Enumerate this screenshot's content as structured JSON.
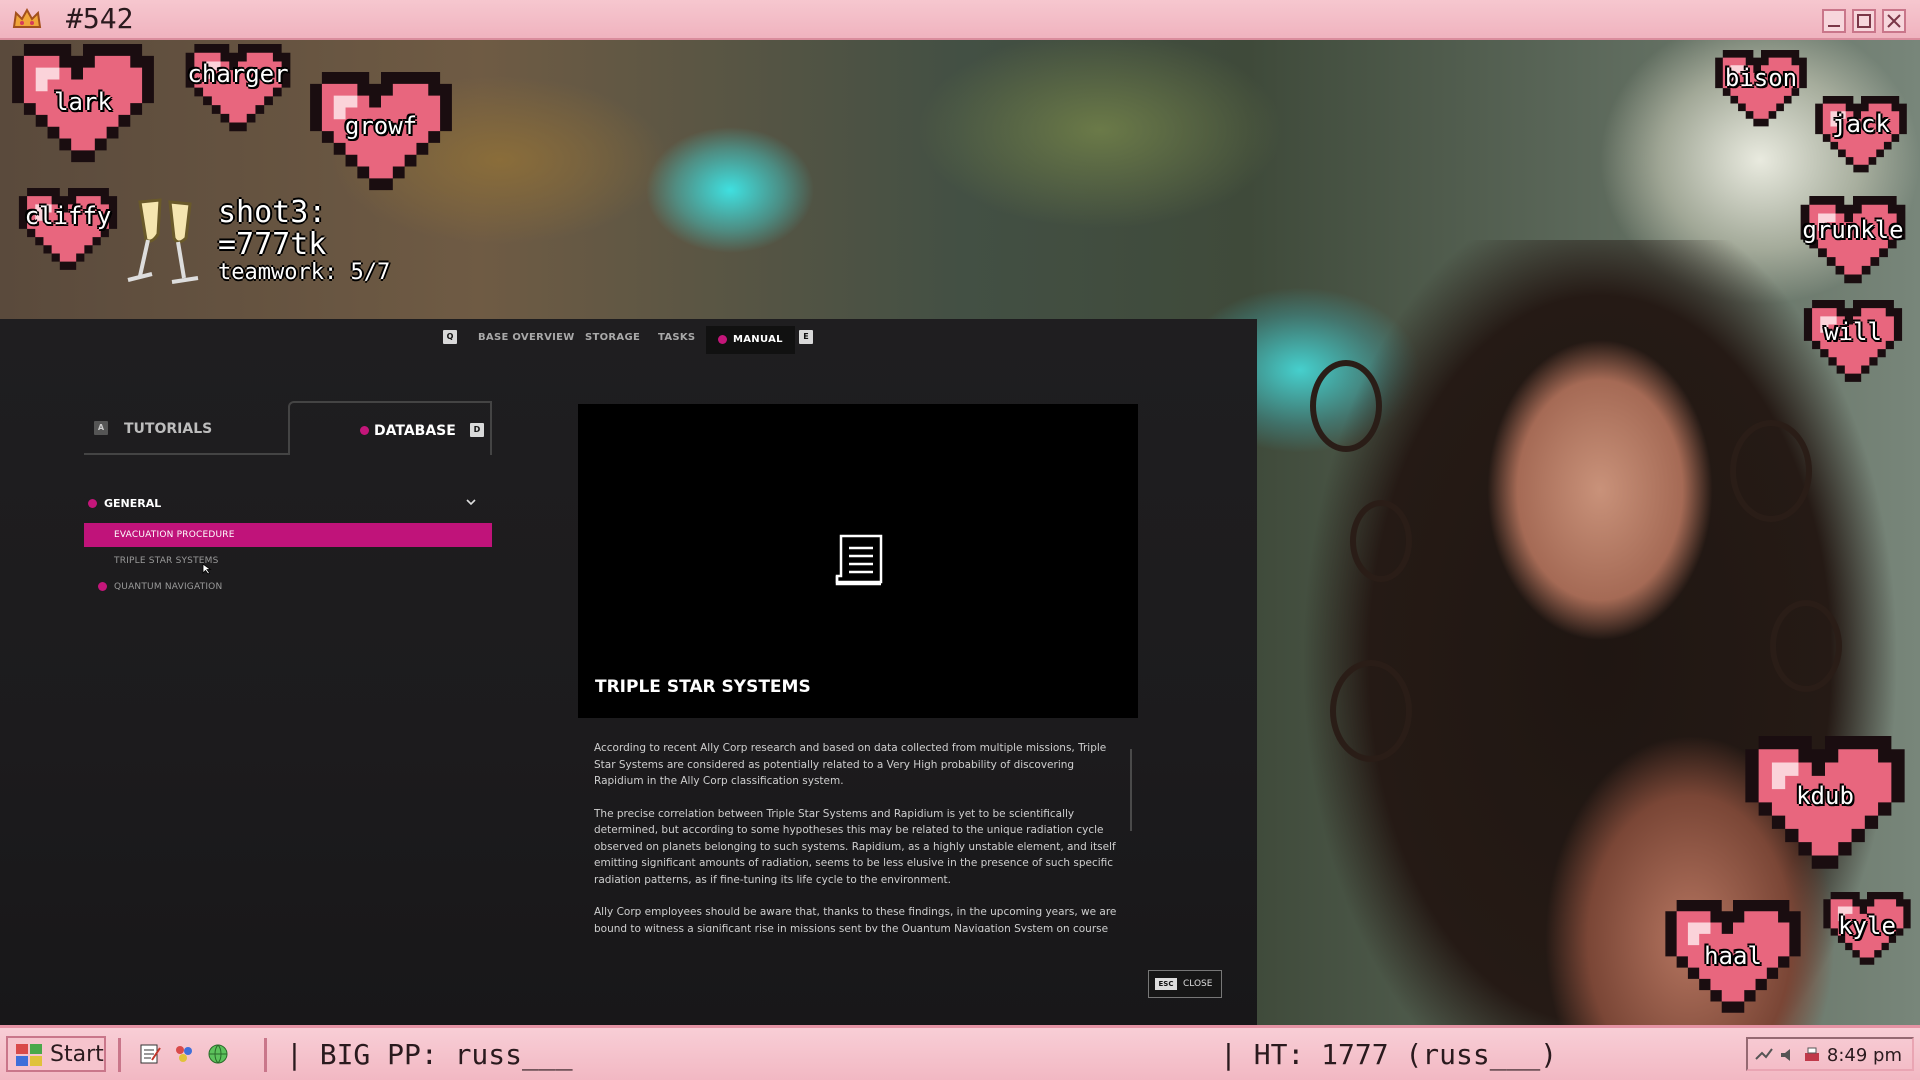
{
  "window": {
    "title": "#542"
  },
  "overlay": {
    "hearts": [
      {
        "name": "lark"
      },
      {
        "name": "charger"
      },
      {
        "name": "growf"
      },
      {
        "name": "cliffy"
      },
      {
        "name": "bison"
      },
      {
        "name": "jack"
      },
      {
        "name": "grunkle"
      },
      {
        "name": "will"
      },
      {
        "name": "kdub"
      },
      {
        "name": "kyle"
      },
      {
        "name": "haal"
      }
    ],
    "shot_label": "shot3:",
    "token_count": "=777tk",
    "teamwork": "teamwork: 5/7"
  },
  "game": {
    "nav": {
      "prev_key": "Q",
      "items": [
        "BASE OVERVIEW",
        "STORAGE",
        "TASKS",
        "MANUAL"
      ],
      "active": "MANUAL",
      "next_key": "E"
    },
    "tabs": {
      "tutorials_key": "A",
      "tutorials": "TUTORIALS",
      "database": "DATABASE",
      "database_key": "D"
    },
    "section": {
      "label": "GENERAL"
    },
    "entries": [
      "EVACUATION PROCEDURE",
      "TRIPLE STAR SYSTEMS",
      "QUANTUM NAVIGATION"
    ],
    "article": {
      "title": "TRIPLE STAR SYSTEMS",
      "paragraphs": [
        "According to recent Ally Corp research and based on data collected from multiple missions, Triple Star Systems are considered as potentially related to a Very High probability of discovering Rapidium in the Ally Corp classification system.",
        "The precise correlation between Triple Star Systems and Rapidium is yet to be scientifically determined, but according to some hypotheses this may be related to the unique radiation cycle observed on planets belonging to such systems. Rapidium, as a highly unstable element, and itself emitting significant amounts of radiation, seems to be less elusive in the presence of such specific radiation patterns, as if fine-tuning its life cycle to the environment.",
        "Ally Corp employees should be aware that, thanks to these findings, in the upcoming years, we are bound to witness a significant rise in missions sent by the Quantum Navigation System on course"
      ]
    },
    "close": {
      "key": "ESC",
      "label": "CLOSE"
    }
  },
  "taskbar": {
    "start": "Start",
    "ticker_left": "| BIG PP: russ___",
    "ticker_right": "| HT: 1777 (russ___)",
    "clock": "8:49 pm"
  },
  "colors": {
    "accent": "#c0137a",
    "taskbar": "#f4bfca",
    "heart": "#e8667e"
  }
}
